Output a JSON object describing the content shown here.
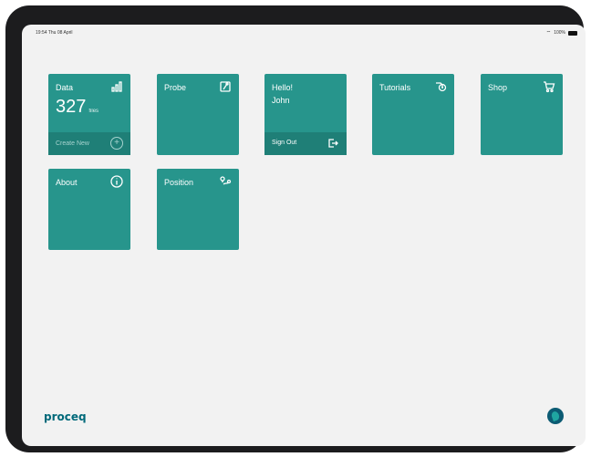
{
  "status_bar": {
    "time_date": "19:54 Thu 08 April",
    "battery": "100%",
    "wifi_icon": "wifi-icon",
    "battery_icon": "battery-icon"
  },
  "tiles": {
    "data": {
      "title": "Data",
      "count": "327",
      "unit": "files",
      "create_label": "Create New",
      "icon": "bar-chart-icon"
    },
    "probe": {
      "title": "Probe",
      "icon": "probe-icon"
    },
    "hello": {
      "title": "Hello!",
      "name": "John",
      "sign_out_label": "Sign Out",
      "icon": "sign-out-icon"
    },
    "tutorials": {
      "title": "Tutorials",
      "icon": "tutorials-icon"
    },
    "shop": {
      "title": "Shop",
      "icon": "cart-icon"
    },
    "about": {
      "title": "About",
      "icon": "info-icon"
    },
    "position": {
      "title": "Position",
      "icon": "position-icon"
    }
  },
  "branding": {
    "logo_text": "proceq",
    "mark_icon": "proceq-mark-icon"
  },
  "colors": {
    "tile": "#27958c",
    "tile_footer": "#1f7f77",
    "background": "#f2f2f2",
    "logo": "#00697a"
  }
}
